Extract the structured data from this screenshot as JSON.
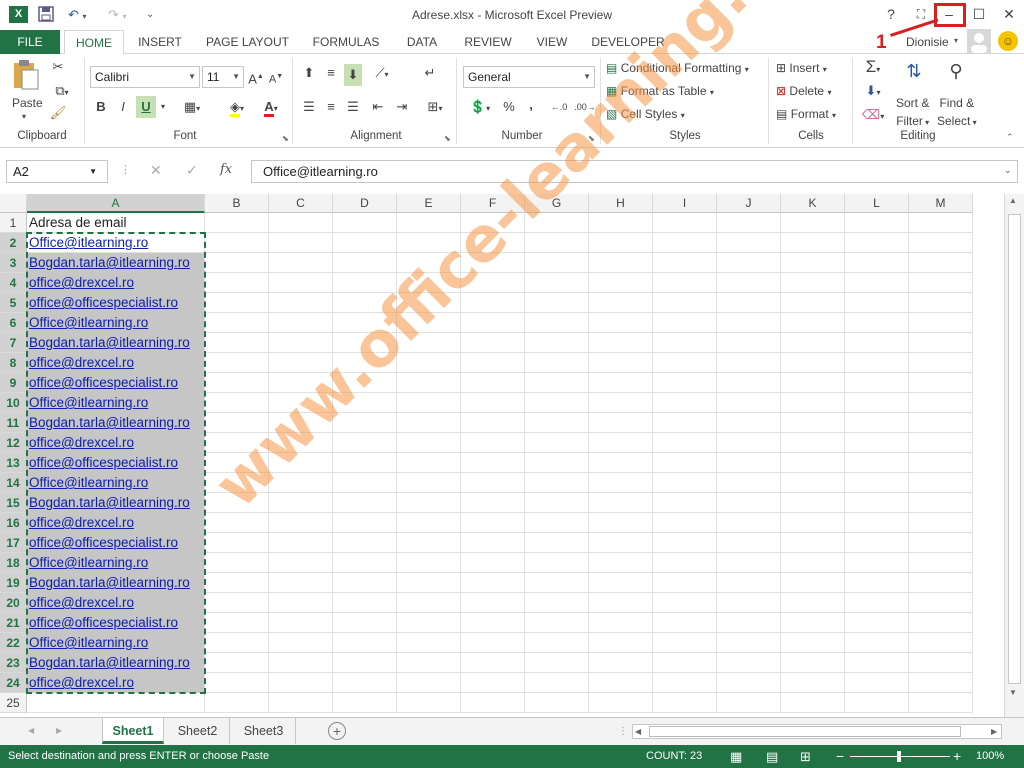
{
  "window": {
    "title": "Adrese.xlsx - Microsoft Excel Preview",
    "app_icon": "X",
    "help": "?",
    "user": "Dionisie",
    "annotation": "1"
  },
  "tabs": [
    "FILE",
    "HOME",
    "INSERT",
    "PAGE LAYOUT",
    "FORMULAS",
    "DATA",
    "REVIEW",
    "VIEW",
    "DEVELOPER"
  ],
  "ribbon": {
    "clipboard": {
      "paste": "Paste",
      "label": "Clipboard"
    },
    "font": {
      "name": "Calibri",
      "size": "11",
      "label": "Font",
      "bold": "B",
      "italic": "I",
      "underline": "U",
      "grow": "A",
      "shrink": "A",
      "color": "A"
    },
    "alignment": {
      "label": "Alignment"
    },
    "number": {
      "format": "General",
      "percent": "%",
      "comma": ",",
      "label": "Number"
    },
    "styles": {
      "conditional": "Conditional Formatting",
      "table": "Format as Table",
      "cellstyles": "Cell Styles",
      "label": "Styles"
    },
    "cells": {
      "insert": "Insert",
      "delete": "Delete",
      "format": "Format",
      "label": "Cells"
    },
    "editing": {
      "sum": "Σ",
      "sort1": "Sort &",
      "sort2": "Filter",
      "find1": "Find &",
      "find2": "Select",
      "label": "Editing"
    }
  },
  "formula_bar": {
    "name_box": "A2",
    "fx": "fx",
    "value": "Office@itlearning.ro"
  },
  "columns": [
    "A",
    "B",
    "C",
    "D",
    "E",
    "F",
    "G",
    "H",
    "I",
    "J",
    "K",
    "L",
    "M"
  ],
  "rows": [
    {
      "n": "1",
      "a": "Adresa de email"
    },
    {
      "n": "2",
      "a": "Office@itlearning.ro"
    },
    {
      "n": "3",
      "a": "Bogdan.tarla@itlearning.ro"
    },
    {
      "n": "4",
      "a": "office@drexcel.ro"
    },
    {
      "n": "5",
      "a": "office@officespecialist.ro"
    },
    {
      "n": "6",
      "a": "Office@itlearning.ro"
    },
    {
      "n": "7",
      "a": "Bogdan.tarla@itlearning.ro"
    },
    {
      "n": "8",
      "a": "office@drexcel.ro"
    },
    {
      "n": "9",
      "a": "office@officespecialist.ro"
    },
    {
      "n": "10",
      "a": "Office@itlearning.ro"
    },
    {
      "n": "11",
      "a": "Bogdan.tarla@itlearning.ro"
    },
    {
      "n": "12",
      "a": "office@drexcel.ro"
    },
    {
      "n": "13",
      "a": "office@officespecialist.ro"
    },
    {
      "n": "14",
      "a": "Office@itlearning.ro"
    },
    {
      "n": "15",
      "a": "Bogdan.tarla@itlearning.ro"
    },
    {
      "n": "16",
      "a": "office@drexcel.ro"
    },
    {
      "n": "17",
      "a": "office@officespecialist.ro"
    },
    {
      "n": "18",
      "a": "Office@itlearning.ro"
    },
    {
      "n": "19",
      "a": "Bogdan.tarla@itlearning.ro"
    },
    {
      "n": "20",
      "a": "office@drexcel.ro"
    },
    {
      "n": "21",
      "a": "office@officespecialist.ro"
    },
    {
      "n": "22",
      "a": "Office@itlearning.ro"
    },
    {
      "n": "23",
      "a": "Bogdan.tarla@itlearning.ro"
    },
    {
      "n": "24",
      "a": "office@drexcel.ro"
    },
    {
      "n": "25",
      "a": ""
    }
  ],
  "sheets": [
    "Sheet1",
    "Sheet2",
    "Sheet3"
  ],
  "status": {
    "message": "Select destination and press ENTER or choose Paste",
    "count": "COUNT: 23",
    "zoom": "100%"
  },
  "watermark": "www.office-learning.ro",
  "colors": {
    "accent": "#217346",
    "link": "#0b1fa8",
    "selection": "#c6c6c6",
    "annotation": "#d92020",
    "watermark": "#f49646"
  }
}
